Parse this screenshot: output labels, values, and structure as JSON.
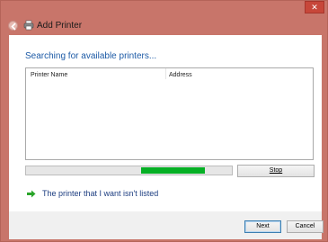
{
  "window": {
    "title": "Add Printer",
    "close_label": "✕"
  },
  "main": {
    "heading": "Searching for available printers...",
    "list": {
      "columns": [
        "Printer Name",
        "Address"
      ],
      "rows": []
    },
    "progress": {
      "fill_start": 0.56,
      "fill_end": 0.87
    },
    "stop_label": "Stop",
    "link_label": "The printer that I want isn't listed"
  },
  "footer": {
    "next_label": "Next",
    "cancel_label": "Cancel"
  },
  "colors": {
    "accent_heading": "#1c5aa6",
    "progress_green": "#06b025",
    "close_red": "#c7473a"
  },
  "icons": {
    "back": "back-arrow-icon",
    "printer": "printer-icon",
    "link_arrow": "green-arrow-icon"
  }
}
